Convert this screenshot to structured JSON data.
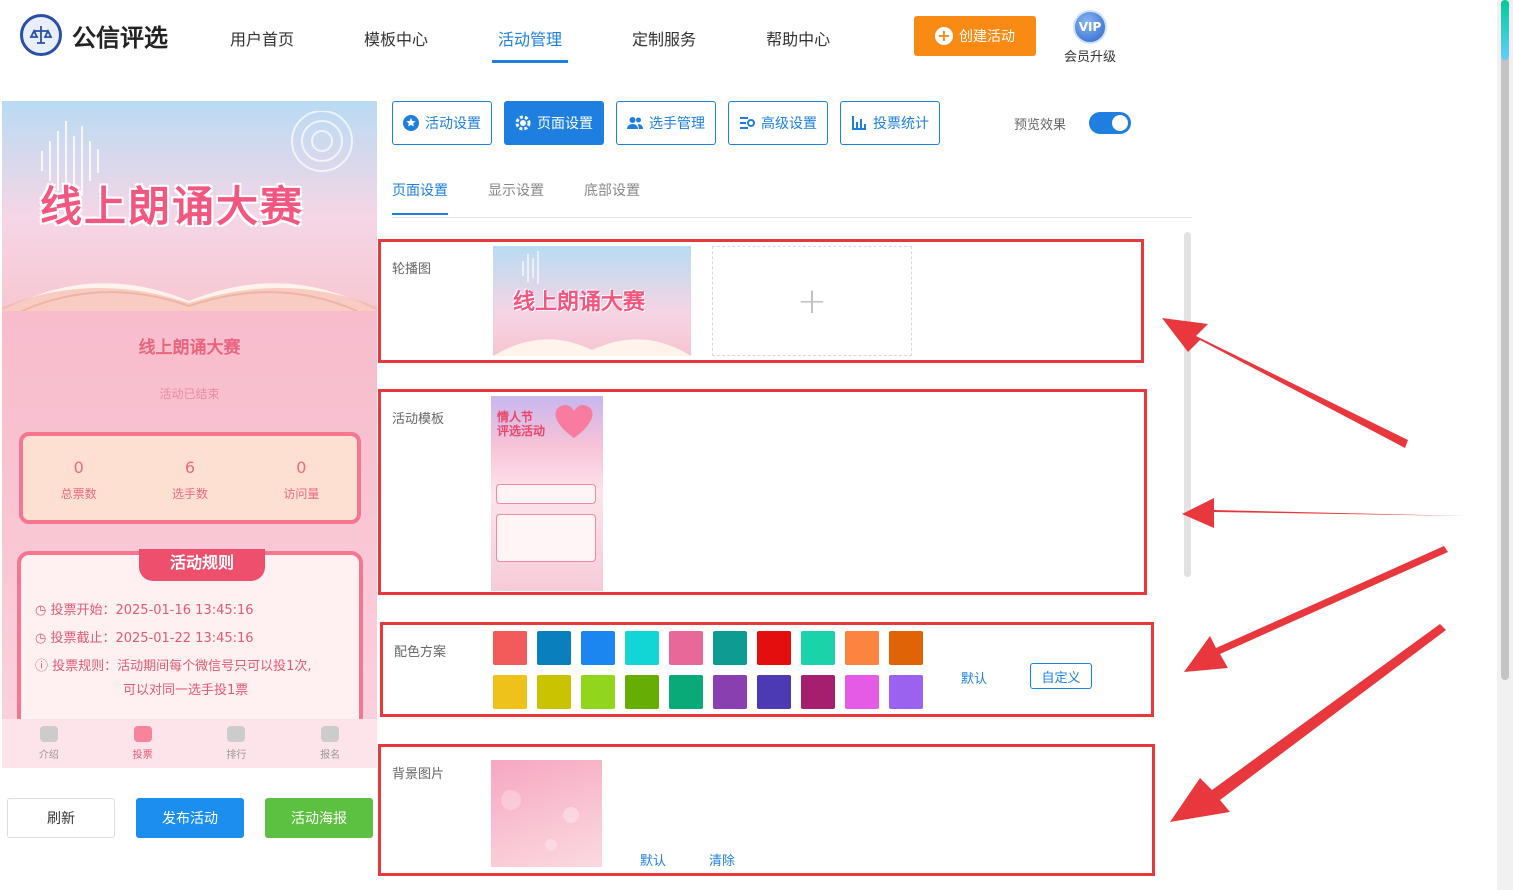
{
  "header": {
    "brand": "公信评选",
    "nav": [
      "用户首页",
      "模板中心",
      "活动管理",
      "定制服务",
      "帮助中心"
    ],
    "active_nav": "活动管理",
    "create_label": "创建活动",
    "vip_badge": "VIP",
    "vip_label": "会员升级"
  },
  "preview": {
    "banner_title": "线上朗诵大赛",
    "title": "线上朗诵大赛",
    "status": "活动已结束",
    "stats": [
      {
        "value": "0",
        "label": "总票数"
      },
      {
        "value": "6",
        "label": "选手数"
      },
      {
        "value": "0",
        "label": "访问量"
      }
    ],
    "rules_title": "活动规则",
    "rules": [
      "投票开始：2025-01-16 13:45:16",
      "投票截止：2025-01-22 13:45:16",
      "投票规则：活动期间每个微信号只可以投1次,",
      "可以对同一选手投1票"
    ],
    "tabs": [
      "介绍",
      "投票",
      "排行",
      "报名"
    ],
    "active_tab": "投票"
  },
  "actions": {
    "refresh": "刷新",
    "publish": "发布活动",
    "poster": "活动海报"
  },
  "toolbar": {
    "buttons": [
      "活动设置",
      "页面设置",
      "选手管理",
      "高级设置",
      "投票统计"
    ],
    "active": "页面设置",
    "preview_label": "预览效果",
    "preview_on": true
  },
  "subtabs": [
    "页面设置",
    "显示设置",
    "底部设置"
  ],
  "sections": {
    "carousel": {
      "label": "轮播图",
      "image_title": "线上朗诵大赛",
      "add": "+"
    },
    "template": {
      "label": "活动模板",
      "thumb_title_1": "情人节",
      "thumb_title_2": "评选活动"
    },
    "colors": {
      "label": "配色方案",
      "default": "默认",
      "custom": "自定义",
      "palette": [
        "#f35b5b",
        "#0a7fbd",
        "#1b86ef",
        "#12d6d6",
        "#e9689a",
        "#0e9c92",
        "#e40e0e",
        "#1bd3a8",
        "#fd8440",
        "#e06406",
        "#eec21a",
        "#c9c301",
        "#91d51c",
        "#66ad06",
        "#0aaa78",
        "#8a3fb0",
        "#4c3ab5",
        "#a61f6e",
        "#e65be5",
        "#9b62f0"
      ]
    },
    "background": {
      "label": "背景图片",
      "default": "默认",
      "clear": "清除"
    }
  }
}
